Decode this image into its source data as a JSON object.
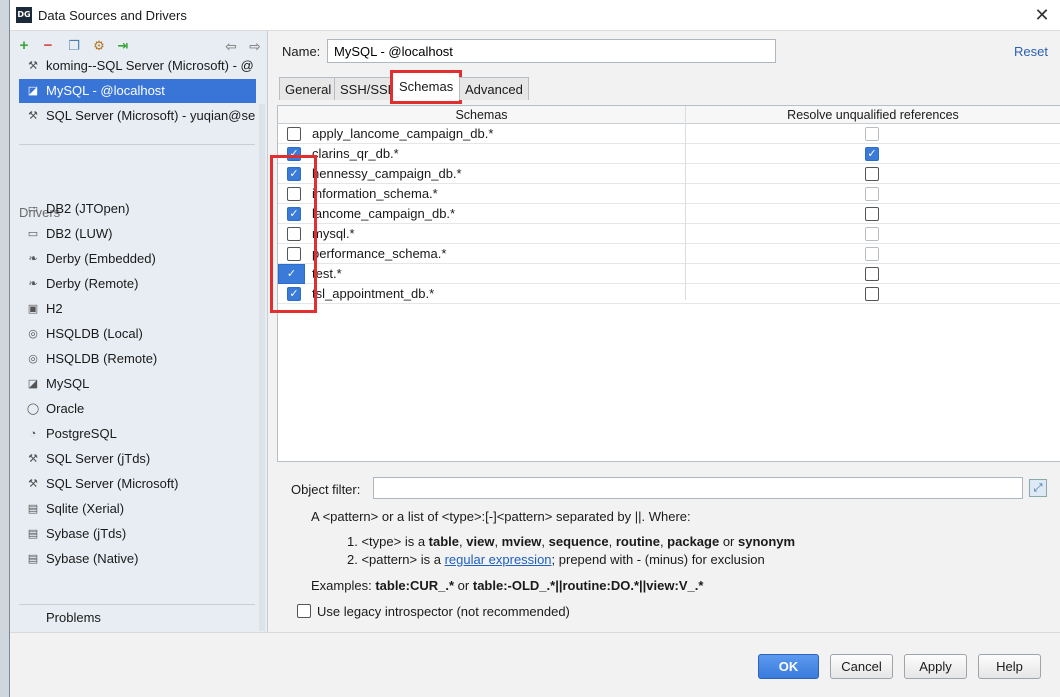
{
  "window": {
    "title": "Data Sources and Drivers",
    "icon_text": "DG"
  },
  "toolbar": {
    "icons": [
      "add-icon",
      "remove-icon",
      "copy-icon",
      "settings-icon",
      "import-icon",
      "back-icon",
      "forward-icon"
    ]
  },
  "datasources": [
    {
      "label": "koming--SQL Server (Microsoft) - @",
      "selected": false
    },
    {
      "label": "MySQL - @localhost",
      "selected": true
    },
    {
      "label": "SQL Server (Microsoft) - yuqian@sel",
      "selected": false
    }
  ],
  "drivers_heading": "Drivers",
  "drivers": [
    "DB2 (JTOpen)",
    "DB2 (LUW)",
    "Derby (Embedded)",
    "Derby (Remote)",
    "H2",
    "HSQLDB (Local)",
    "HSQLDB (Remote)",
    "MySQL",
    "Oracle",
    "PostgreSQL",
    "SQL Server (jTds)",
    "SQL Server (Microsoft)",
    "Sqlite (Xerial)",
    "Sybase (jTds)",
    "Sybase (Native)"
  ],
  "problems_label": "Problems",
  "form": {
    "name_label": "Name:",
    "name_value": "MySQL - @localhost",
    "reset_label": "Reset"
  },
  "tabs": [
    "General",
    "SSH/SSL",
    "Schemas",
    "Advanced"
  ],
  "active_tab": "Schemas",
  "table": {
    "col_schemas": "Schemas",
    "col_resolve": "Resolve unqualified references",
    "rows": [
      {
        "name": "apply_lancome_campaign_db.*",
        "checked": false,
        "resolve": false,
        "resolve_dim": true
      },
      {
        "name": "clarins_qr_db.*",
        "checked": true,
        "resolve": true,
        "resolve_dim": false
      },
      {
        "name": "hennessy_campaign_db.*",
        "checked": true,
        "resolve": false,
        "resolve_dim": false
      },
      {
        "name": "information_schema.*",
        "checked": false,
        "resolve": false,
        "resolve_dim": true
      },
      {
        "name": "lancome_campaign_db.*",
        "checked": true,
        "resolve": false,
        "resolve_dim": false
      },
      {
        "name": "mysql.*",
        "checked": false,
        "resolve": false,
        "resolve_dim": true
      },
      {
        "name": "performance_schema.*",
        "checked": false,
        "resolve": false,
        "resolve_dim": true
      },
      {
        "name": "test.*",
        "checked": true,
        "resolve": false,
        "resolve_dim": false,
        "row_selected": true
      },
      {
        "name": "tsl_appointment_db.*",
        "checked": true,
        "resolve": false,
        "resolve_dim": false
      }
    ]
  },
  "filter": {
    "label": "Object filter:",
    "value": "",
    "help_line1": "A <pattern> or a list of <type>:[-]<pattern> separated by ||. Where:",
    "help_item1_pre": "1. <type> is a ",
    "help_item1_types": [
      "table",
      "view",
      "mview",
      "sequence",
      "routine",
      "package"
    ],
    "help_item1_or": " or ",
    "help_item1_last": "synonym",
    "help_item2_pre": "2. <pattern> is a ",
    "help_item2_link": "regular expression",
    "help_item2_post": "; prepend with - (minus) for exclusion",
    "examples_pre": "Examples: ",
    "examples_a": "table:CUR_.*",
    "examples_or": " or ",
    "examples_b": "table:-OLD_.*||routine:DO.*||view:V_.*"
  },
  "legacy": {
    "label": "Use legacy introspector (not recommended)",
    "checked": false
  },
  "buttons": {
    "ok": "OK",
    "cancel": "Cancel",
    "apply": "Apply",
    "help": "Help"
  },
  "colors": {
    "accent": "#3875d7",
    "highlight": "#e12e2e"
  }
}
